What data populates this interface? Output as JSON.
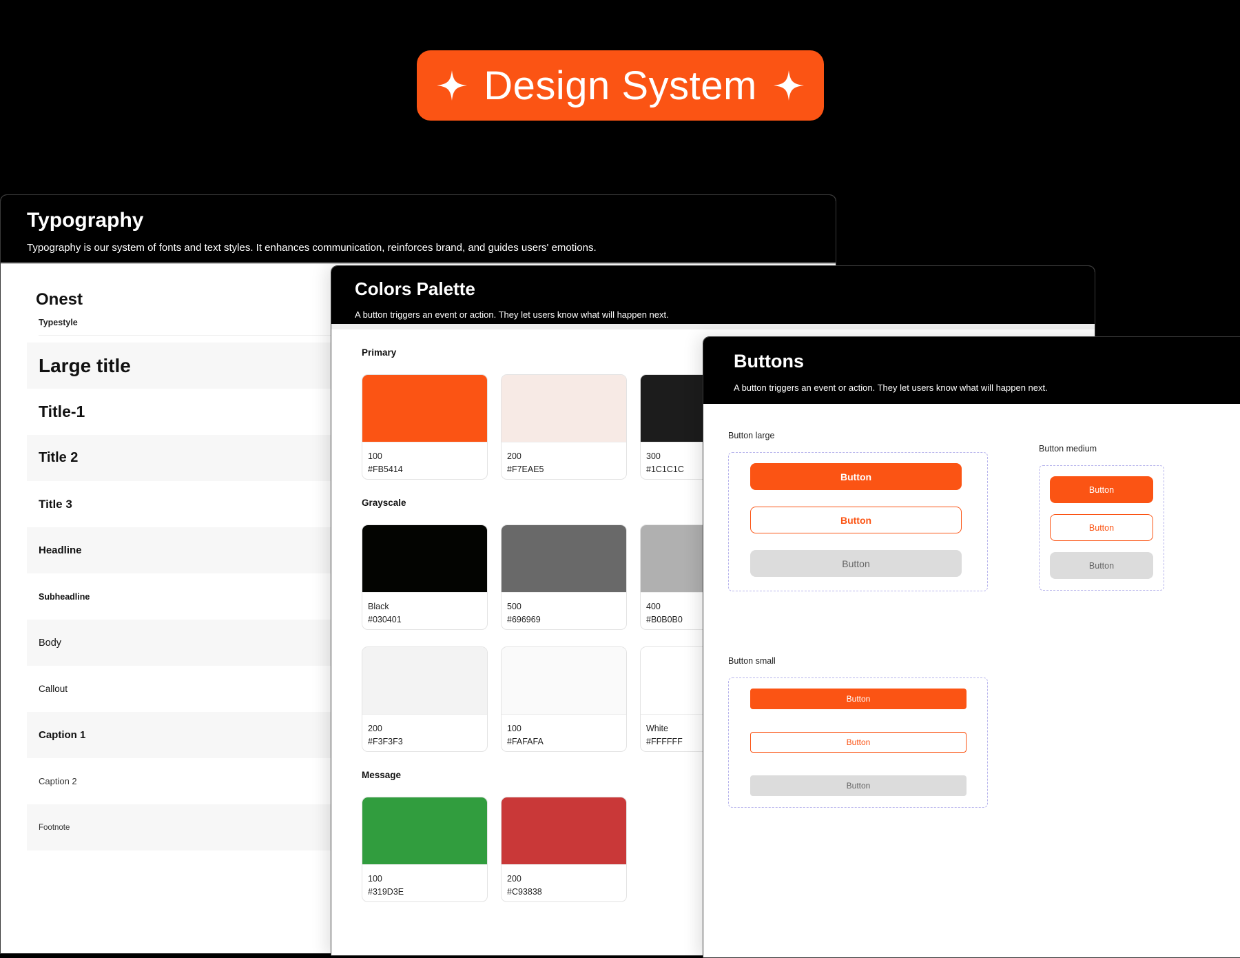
{
  "hero": {
    "title": "Design System"
  },
  "colors_theme": {
    "accent": "#FB5414",
    "dashed": "#b7b4ec"
  },
  "typography": {
    "title": "Typography",
    "description": "Typography is our system of fonts and text styles. It enhances communication, reinforces brand, and guides users' emotions.",
    "font_name": "Onest",
    "typestyle_label": "Typestyle",
    "styles": [
      "Large title",
      "Title-1",
      "Title 2",
      "Title 3",
      "Headline",
      "Subheadline",
      "Body",
      "Callout",
      "Caption 1",
      "Caption 2",
      "Footnote"
    ]
  },
  "palette": {
    "title": "Colors Palette",
    "description": "A button triggers an event or action. They let users know what will happen next.",
    "groups": [
      {
        "label": "Primary",
        "rows": [
          [
            {
              "name": "100",
              "hex": "#FB5414",
              "color": "#FB5414"
            },
            {
              "name": "200",
              "hex": "#F7EAE5",
              "color": "#F7EAE5"
            },
            {
              "name": "300",
              "hex": "#1C1C1C",
              "color": "#1C1C1C"
            }
          ]
        ]
      },
      {
        "label": "Grayscale",
        "rows": [
          [
            {
              "name": "Black",
              "hex": "#030401",
              "color": "#030401"
            },
            {
              "name": "500",
              "hex": "#696969",
              "color": "#696969"
            },
            {
              "name": "400",
              "hex": "#B0B0B0",
              "color": "#B0B0B0"
            }
          ],
          [
            {
              "name": "200",
              "hex": "#F3F3F3",
              "color": "#F3F3F3"
            },
            {
              "name": "100",
              "hex": "#FAFAFA",
              "color": "#FAFAFA"
            },
            {
              "name": "White",
              "hex": "#FFFFFF",
              "color": "#FFFFFF"
            }
          ]
        ]
      },
      {
        "label": "Message",
        "rows": [
          [
            {
              "name": "100",
              "hex": "#319D3E",
              "color": "#319D3E"
            },
            {
              "name": "200",
              "hex": "#C93838",
              "color": "#C93838"
            }
          ]
        ]
      }
    ]
  },
  "buttons": {
    "title": "Buttons",
    "description": "A button triggers an event or action. They let users know what will happen next.",
    "large": {
      "label": "Button large",
      "primary": "Button",
      "outline": "Button",
      "disabled": "Button"
    },
    "medium": {
      "label": "Button medium",
      "primary": "Button",
      "outline": "Button",
      "disabled": "Button"
    },
    "small": {
      "label": "Button small",
      "primary": "Button",
      "outline": "Button",
      "disabled": "Button"
    }
  }
}
